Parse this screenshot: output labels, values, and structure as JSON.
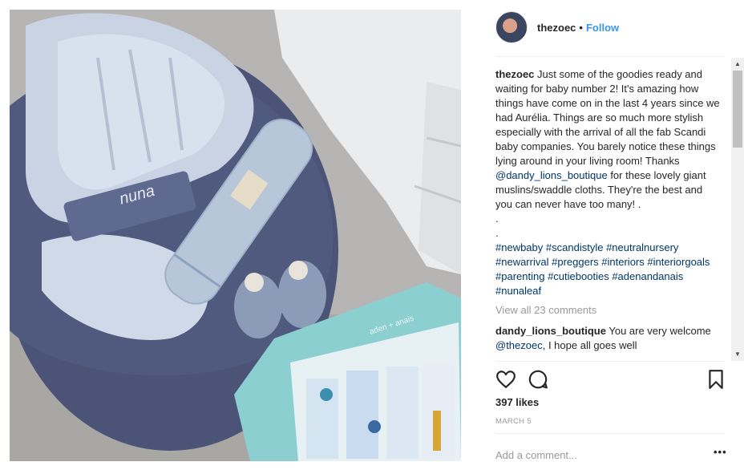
{
  "post": {
    "image_alt": "Baby bouncer with muslins, swaddle cloths and booties",
    "brand_logo": "nuna",
    "box_logo": "aden + anais"
  },
  "header": {
    "username": "thezoec",
    "dot": "•",
    "follow_label": "Follow"
  },
  "caption": {
    "username": "thezoec",
    "text_1": "Just some of the goodies ready and waiting for baby number 2! It's amazing how things have come on in the last 4 years since we had Aurélia. Things are so much more stylish especially with the arrival of all the fab Scandi baby companies. You barely notice these things lying around in your living room! Thanks ",
    "mention": "@dandy_lions_boutique",
    "text_2": " for these lovely giant muslins/swaddle cloths. They're the best and you can never have too many! .",
    "dot_line_1": ".",
    "dot_line_2": ".",
    "hashtags": [
      "#newbaby",
      "#scandistyle",
      "#neutralnursery",
      "#newarrival",
      "#preggers",
      "#interiors",
      "#interiorgoals",
      "#parenting",
      "#cutiebooties",
      "#adenandanais",
      "#nunaleaf"
    ]
  },
  "view_all_label": "View all 23 comments",
  "comment": {
    "username": "dandy_lions_boutique",
    "text_1": "You are very welcome ",
    "mention": "@thezoec",
    "text_2": ", I hope all goes well"
  },
  "scrollbar": {
    "up_glyph": "▲",
    "down_glyph": "▼"
  },
  "likes_label": "397 likes",
  "date_label": "MARCH 5",
  "add_comment_placeholder": "Add a comment...",
  "more_glyph": "•••",
  "icons": [
    "heart-icon",
    "comment-icon",
    "bookmark-icon"
  ]
}
